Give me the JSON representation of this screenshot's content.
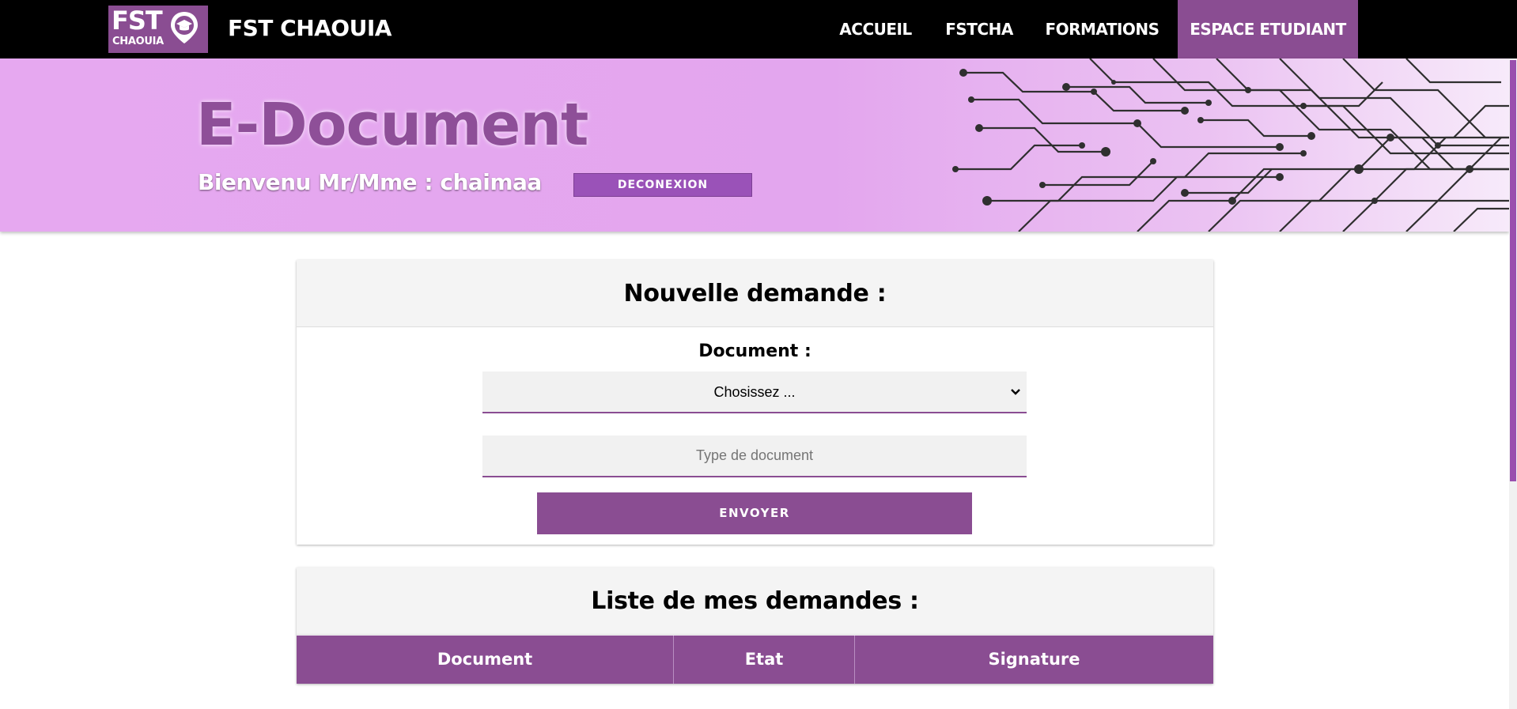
{
  "header": {
    "logo_main": "FST",
    "logo_sub": "CHAOUIA",
    "brand": "FST CHAOUIA",
    "nav": [
      {
        "label": "ACCUEIL"
      },
      {
        "label": "FSTCHA"
      },
      {
        "label": "FORMATIONS"
      },
      {
        "label": "ESPACE ETUDIANT"
      }
    ],
    "active_nav": "ESPACE ETUDIANT"
  },
  "hero": {
    "title": "E-Document",
    "welcome": "Bienvenu Mr/Mme : chaimaa",
    "logout_label": "DECONEXION"
  },
  "request_form": {
    "title": "Nouvelle demande :",
    "document_label": "Document :",
    "select_value": "Chosissez ...",
    "type_placeholder": "Type de document",
    "submit_label": "ENVOYER"
  },
  "requests_list": {
    "title": "Liste de mes demandes :",
    "columns": [
      "Document",
      "Etat",
      "Signature"
    ],
    "rows": []
  },
  "colors": {
    "accent": "#8a4d92",
    "hero_bg": "#e6a8f0",
    "nav_bg": "#000000"
  }
}
